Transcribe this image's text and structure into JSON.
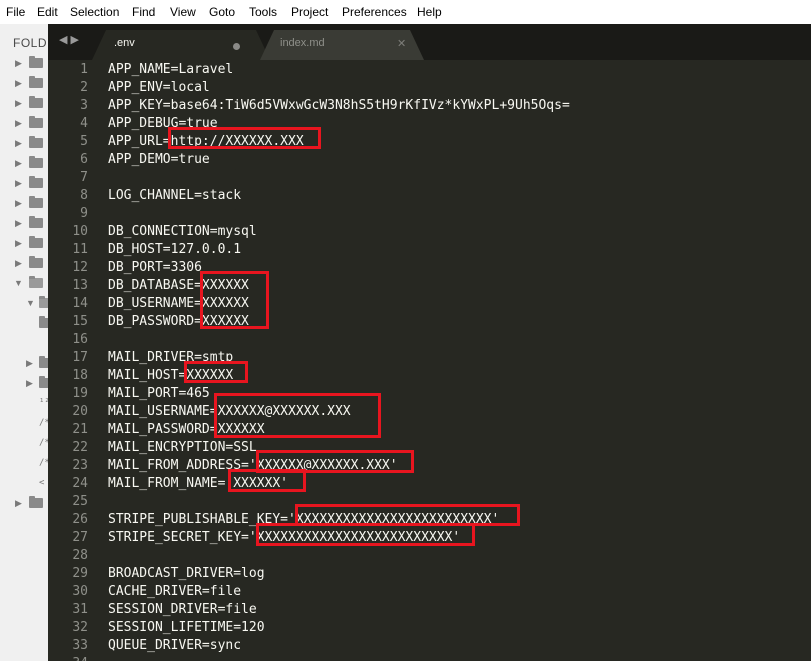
{
  "menu": [
    "File",
    "Edit",
    "Selection",
    "Find",
    "View",
    "Goto",
    "Tools",
    "Project",
    "Preferences",
    "Help"
  ],
  "sidebar": {
    "title": "FOLD"
  },
  "tabs": [
    {
      "label": ".env",
      "active": true,
      "modified": true
    },
    {
      "label": "index.md",
      "active": false,
      "modified": false
    }
  ],
  "editor": {
    "lines": [
      {
        "num": "1",
        "text": "APP_NAME=Laravel"
      },
      {
        "num": "2",
        "text": "APP_ENV=local"
      },
      {
        "num": "3",
        "text": "APP_KEY=base64:TiW6d5VWxwGcW3N8hS5tH9rKfIVz*kYWxPL+9Uh5Oqs="
      },
      {
        "num": "4",
        "text": "APP_DEBUG=true"
      },
      {
        "num": "5",
        "text": "APP_URL=http://XXXXXX.XXX"
      },
      {
        "num": "6",
        "text": "APP_DEMO=true"
      },
      {
        "num": "7",
        "text": ""
      },
      {
        "num": "8",
        "text": "LOG_CHANNEL=stack"
      },
      {
        "num": "9",
        "text": ""
      },
      {
        "num": "10",
        "text": "DB_CONNECTION=mysql"
      },
      {
        "num": "11",
        "text": "DB_HOST=127.0.0.1"
      },
      {
        "num": "12",
        "text": "DB_PORT=3306"
      },
      {
        "num": "13",
        "text": "DB_DATABASE=XXXXXX"
      },
      {
        "num": "14",
        "text": "DB_USERNAME=XXXXXX"
      },
      {
        "num": "15",
        "text": "DB_PASSWORD=XXXXXX"
      },
      {
        "num": "16",
        "text": ""
      },
      {
        "num": "17",
        "text": "MAIL_DRIVER=smtp"
      },
      {
        "num": "18",
        "text": "MAIL_HOST=XXXXXX"
      },
      {
        "num": "19",
        "text": "MAIL_PORT=465"
      },
      {
        "num": "20",
        "text": "MAIL_USERNAME=XXXXXX@XXXXXX.XXX"
      },
      {
        "num": "21",
        "text": "MAIL_PASSWORD=XXXXXX"
      },
      {
        "num": "22",
        "text": "MAIL_ENCRYPTION=SSL"
      },
      {
        "num": "23",
        "text": "MAIL_FROM_ADDRESS='XXXXXX@XXXXXX.XXX'"
      },
      {
        "num": "24",
        "text": "MAIL_FROM_NAME='XXXXXX'"
      },
      {
        "num": "25",
        "text": ""
      },
      {
        "num": "26",
        "text": "STRIPE_PUBLISHABLE_KEY='XXXXXXXXXXXXXXXXXXXXXXXXX'"
      },
      {
        "num": "27",
        "text": "STRIPE_SECRET_KEY='XXXXXXXXXXXXXXXXXXXXXXXXX'"
      },
      {
        "num": "28",
        "text": ""
      },
      {
        "num": "29",
        "text": "BROADCAST_DRIVER=log"
      },
      {
        "num": "30",
        "text": "CACHE_DRIVER=file"
      },
      {
        "num": "31",
        "text": "SESSION_DRIVER=file"
      },
      {
        "num": "32",
        "text": "SESSION_LIFETIME=120"
      },
      {
        "num": "33",
        "text": "QUEUE_DRIVER=sync"
      },
      {
        "num": "34",
        "text": ""
      }
    ]
  },
  "colors": {
    "editor_bg": "#272822",
    "text": "#f8f8f2",
    "gutter": "#8f908a",
    "redaction_box": "#e8151f"
  }
}
